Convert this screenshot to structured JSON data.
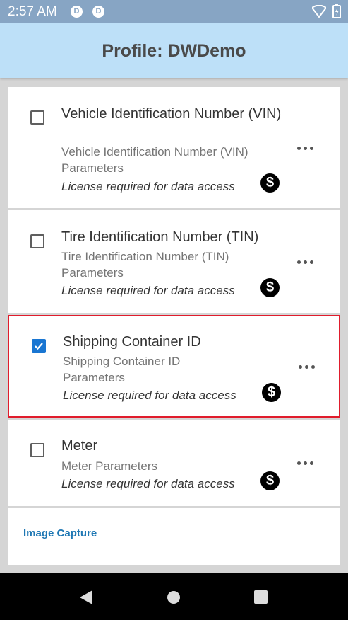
{
  "status_bar": {
    "time": "2:57 AM",
    "app_icons": [
      "D",
      "D"
    ]
  },
  "app_bar": {
    "title": "Profile: DWDemo"
  },
  "decoders": [
    {
      "title": "Vehicle Identification Number (VIN)",
      "subtitle": "Vehicle Identification Number (VIN) Parameters",
      "license": "License required for data access",
      "checked": false
    },
    {
      "title": "Tire Identification Number (TIN)",
      "subtitle": "Tire Identification Number (TIN) Parameters",
      "license": "License required for data access",
      "checked": false
    },
    {
      "title": "Shipping Container ID",
      "subtitle": "Shipping Container ID Parameters",
      "license": "License required for data access",
      "checked": true
    },
    {
      "title": "Meter",
      "subtitle": "Meter Parameters",
      "license": "License required for data access",
      "checked": false
    }
  ],
  "image_capture": {
    "label": "Image Capture"
  },
  "icons": {
    "dollar": "dollar-icon",
    "more": "more-options-icon",
    "back": "nav-back-icon",
    "home": "nav-home-icon",
    "recents": "nav-recents-icon"
  },
  "colors": {
    "status_bar": "#87a5c4",
    "app_bar": "#bde0f8",
    "checkbox_checked": "#1976d2",
    "selection_border": "#e01c2c",
    "link": "#1f78b4"
  }
}
